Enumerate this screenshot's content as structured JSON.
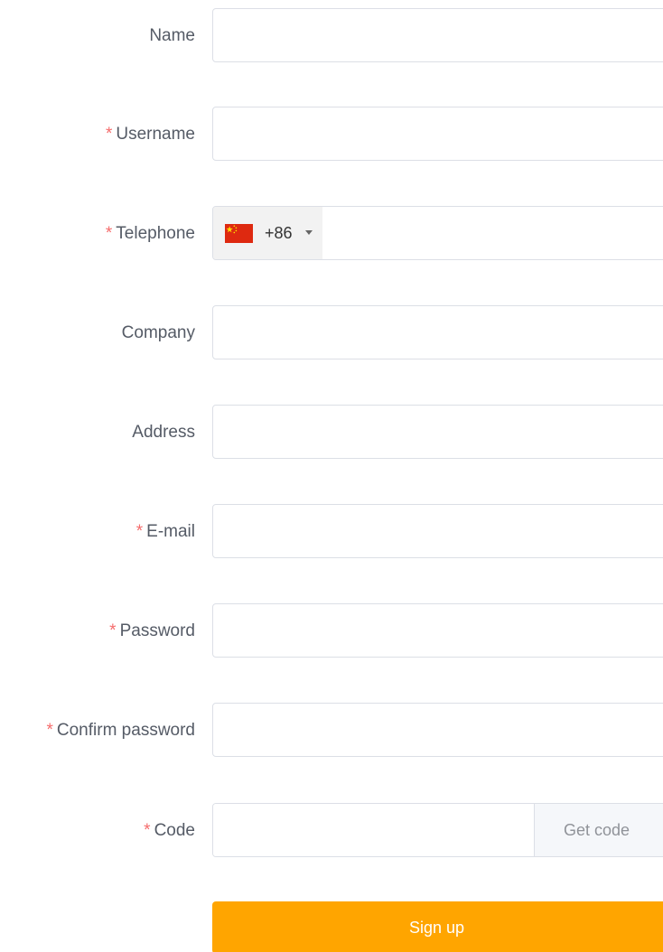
{
  "form": {
    "name": {
      "label": "Name",
      "required": false,
      "value": "",
      "placeholder": ""
    },
    "username": {
      "label": "Username",
      "required": true,
      "value": "",
      "placeholder": ""
    },
    "telephone": {
      "label": "Telephone",
      "required": true,
      "country_code": "+86",
      "country_flag": "china-flag-icon",
      "value": "",
      "placeholder": ""
    },
    "company": {
      "label": "Company",
      "required": false,
      "value": "",
      "placeholder": ""
    },
    "address": {
      "label": "Address",
      "required": false,
      "value": "",
      "placeholder": ""
    },
    "email": {
      "label": "E-mail",
      "required": true,
      "value": "",
      "placeholder": ""
    },
    "password": {
      "label": "Password",
      "required": true,
      "value": "",
      "placeholder": ""
    },
    "confirm_password": {
      "label": "Confirm password",
      "required": true,
      "value": "",
      "placeholder": ""
    },
    "code": {
      "label": "Code",
      "required": true,
      "value": "",
      "placeholder": "",
      "get_code_label": "Get code"
    },
    "required_marker": "*",
    "submit_label": "Sign up"
  },
  "colors": {
    "accent": "#ffa500",
    "required": "#f56c6c",
    "label": "#555b66",
    "border": "#dcdfe6"
  }
}
